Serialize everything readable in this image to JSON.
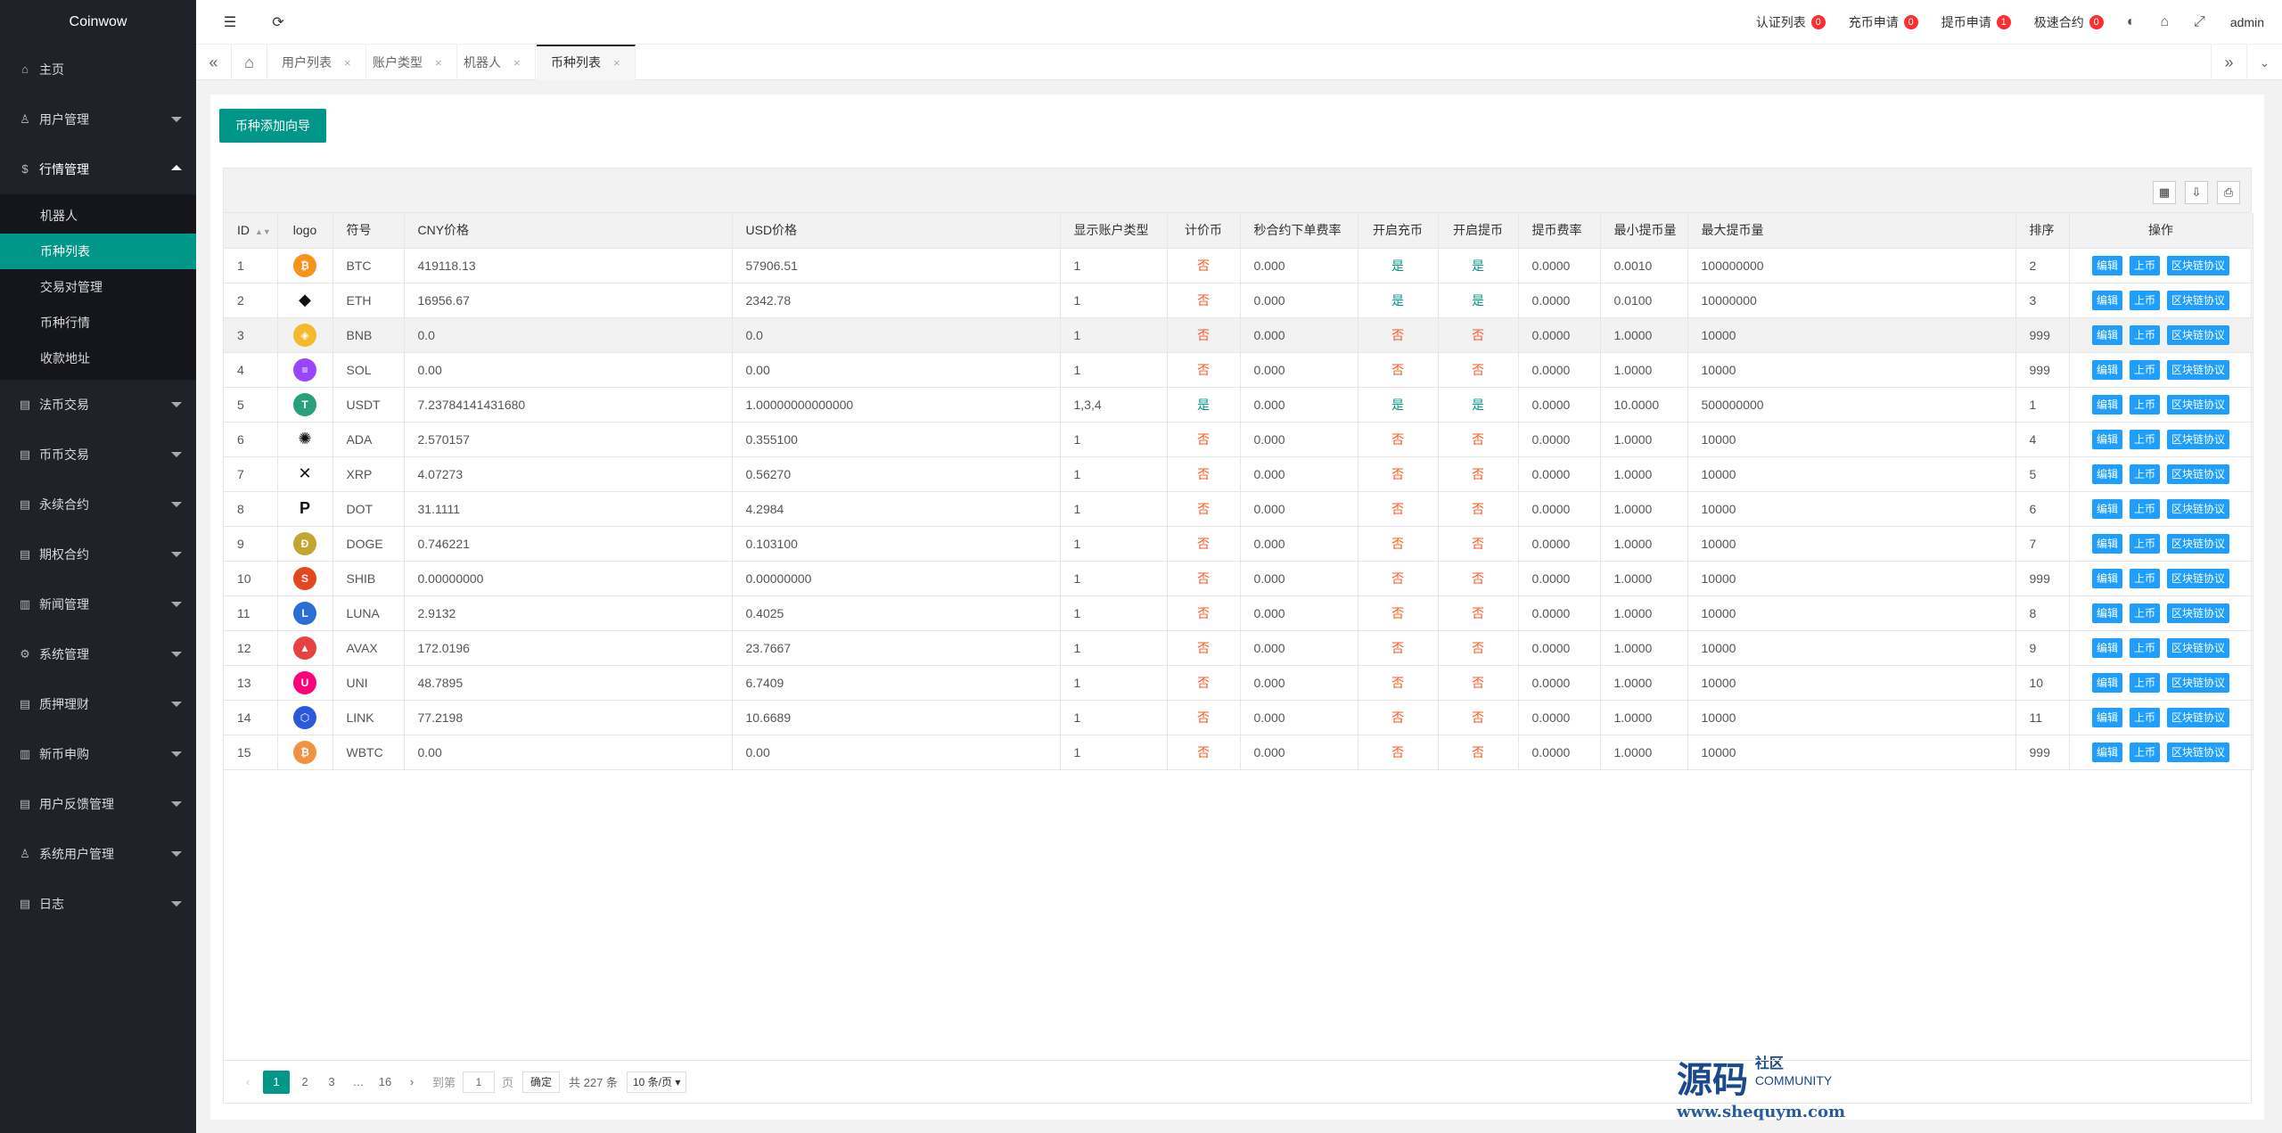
{
  "app": {
    "name": "Coinwow"
  },
  "sidebar": {
    "items": [
      {
        "label": "主页",
        "icon": "home-icon"
      },
      {
        "label": "用户管理",
        "icon": "user-icon"
      },
      {
        "label": "行情管理",
        "icon": "dollar-icon",
        "open": true,
        "children": [
          "机器人",
          "币种列表",
          "交易对管理",
          "币种行情",
          "收款地址"
        ],
        "active_child": 1
      },
      {
        "label": "法币交易",
        "icon": "doc-icon"
      },
      {
        "label": "币币交易",
        "icon": "doc-icon"
      },
      {
        "label": "永续合约",
        "icon": "doc-icon"
      },
      {
        "label": "期权合约",
        "icon": "doc-icon"
      },
      {
        "label": "新闻管理",
        "icon": "news-icon"
      },
      {
        "label": "系统管理",
        "icon": "gear-icon"
      },
      {
        "label": "质押理财",
        "icon": "doc-icon"
      },
      {
        "label": "新币申购",
        "icon": "news-icon"
      },
      {
        "label": "用户反馈管理",
        "icon": "doc-icon"
      },
      {
        "label": "系统用户管理",
        "icon": "user-icon"
      },
      {
        "label": "日志",
        "icon": "doc-icon"
      }
    ]
  },
  "header": {
    "links": [
      {
        "label": "认证列表",
        "count": "0"
      },
      {
        "label": "充币申请",
        "count": "0"
      },
      {
        "label": "提币申请",
        "count": "1"
      },
      {
        "label": "极速合约",
        "count": "0"
      }
    ],
    "user": "admin"
  },
  "tabs": [
    {
      "label": "用户列表"
    },
    {
      "label": "账户类型"
    },
    {
      "label": "机器人"
    },
    {
      "label": "币种列表",
      "active": true
    }
  ],
  "main": {
    "add_button": "币种添加向导",
    "columns": [
      "ID",
      "logo",
      "符号",
      "CNY价格",
      "USD价格",
      "显示账户类型",
      "计价币",
      "秒合约下单费率",
      "开启充币",
      "开启提币",
      "提币费率",
      "最小提币量",
      "最大提币量",
      "排序",
      "操作"
    ],
    "rows": [
      {
        "id": "1",
        "color": "#f7931a",
        "glyph": "₿",
        "symbol": "BTC",
        "cny": "419118.13",
        "usd": "57906.51",
        "acct": "1",
        "quote": "否",
        "fee": "0.000",
        "dep": "是",
        "wd": "是",
        "wdfee": "0.0000",
        "min": "0.0010",
        "max": "100000000",
        "sort": "2"
      },
      {
        "id": "2",
        "color": "#ffffff",
        "glyph": "◆",
        "symbol": "ETH",
        "cny": "16956.67",
        "usd": "2342.78",
        "acct": "1",
        "quote": "否",
        "fee": "0.000",
        "dep": "是",
        "wd": "是",
        "wdfee": "0.0000",
        "min": "0.0100",
        "max": "10000000",
        "sort": "3"
      },
      {
        "id": "3",
        "color": "#f3ba2f",
        "glyph": "◈",
        "symbol": "BNB",
        "cny": "0.0",
        "usd": "0.0",
        "acct": "1",
        "quote": "否",
        "fee": "0.000",
        "dep": "否",
        "wd": "否",
        "wdfee": "0.0000",
        "min": "1.0000",
        "max": "10000",
        "sort": "999"
      },
      {
        "id": "4",
        "color": "#9945ff",
        "glyph": "≡",
        "symbol": "SOL",
        "cny": "0.00",
        "usd": "0.00",
        "acct": "1",
        "quote": "否",
        "fee": "0.000",
        "dep": "否",
        "wd": "否",
        "wdfee": "0.0000",
        "min": "1.0000",
        "max": "10000",
        "sort": "999"
      },
      {
        "id": "5",
        "color": "#26a17b",
        "glyph": "T",
        "symbol": "USDT",
        "cny": "7.23784141431680",
        "usd": "1.00000000000000",
        "acct": "1,3,4",
        "quote": "是",
        "fee": "0.000",
        "dep": "是",
        "wd": "是",
        "wdfee": "0.0000",
        "min": "10.0000",
        "max": "500000000",
        "sort": "1"
      },
      {
        "id": "6",
        "color": "#ffffff",
        "glyph": "✺",
        "symbol": "ADA",
        "cny": "2.570157",
        "usd": "0.355100",
        "acct": "1",
        "quote": "否",
        "fee": "0.000",
        "dep": "否",
        "wd": "否",
        "wdfee": "0.0000",
        "min": "1.0000",
        "max": "10000",
        "sort": "4"
      },
      {
        "id": "7",
        "color": "#ffffff",
        "glyph": "✕",
        "symbol": "XRP",
        "cny": "4.07273",
        "usd": "0.56270",
        "acct": "1",
        "quote": "否",
        "fee": "0.000",
        "dep": "否",
        "wd": "否",
        "wdfee": "0.0000",
        "min": "1.0000",
        "max": "10000",
        "sort": "5"
      },
      {
        "id": "8",
        "color": "#ffffff",
        "glyph": "P",
        "symbol": "DOT",
        "cny": "31.1111",
        "usd": "4.2984",
        "acct": "1",
        "quote": "否",
        "fee": "0.000",
        "dep": "否",
        "wd": "否",
        "wdfee": "0.0000",
        "min": "1.0000",
        "max": "10000",
        "sort": "6"
      },
      {
        "id": "9",
        "color": "#c2a633",
        "glyph": "Ð",
        "symbol": "DOGE",
        "cny": "0.746221",
        "usd": "0.103100",
        "acct": "1",
        "quote": "否",
        "fee": "0.000",
        "dep": "否",
        "wd": "否",
        "wdfee": "0.0000",
        "min": "1.0000",
        "max": "10000",
        "sort": "7"
      },
      {
        "id": "10",
        "color": "#e5461f",
        "glyph": "S",
        "symbol": "SHIB",
        "cny": "0.00000000",
        "usd": "0.00000000",
        "acct": "1",
        "quote": "否",
        "fee": "0.000",
        "dep": "否",
        "wd": "否",
        "wdfee": "0.0000",
        "min": "1.0000",
        "max": "10000",
        "sort": "999"
      },
      {
        "id": "11",
        "color": "#2b6fd6",
        "glyph": "L",
        "symbol": "LUNA",
        "cny": "2.9132",
        "usd": "0.4025",
        "acct": "1",
        "quote": "否",
        "fee": "0.000",
        "dep": "否",
        "wd": "否",
        "wdfee": "0.0000",
        "min": "1.0000",
        "max": "10000",
        "sort": "8"
      },
      {
        "id": "12",
        "color": "#e84142",
        "glyph": "▲",
        "symbol": "AVAX",
        "cny": "172.0196",
        "usd": "23.7667",
        "acct": "1",
        "quote": "否",
        "fee": "0.000",
        "dep": "否",
        "wd": "否",
        "wdfee": "0.0000",
        "min": "1.0000",
        "max": "10000",
        "sort": "9"
      },
      {
        "id": "13",
        "color": "#ff007a",
        "glyph": "U",
        "symbol": "UNI",
        "cny": "48.7895",
        "usd": "6.7409",
        "acct": "1",
        "quote": "否",
        "fee": "0.000",
        "dep": "否",
        "wd": "否",
        "wdfee": "0.0000",
        "min": "1.0000",
        "max": "10000",
        "sort": "10"
      },
      {
        "id": "14",
        "color": "#2a5ada",
        "glyph": "⬡",
        "symbol": "LINK",
        "cny": "77.2198",
        "usd": "10.6689",
        "acct": "1",
        "quote": "否",
        "fee": "0.000",
        "dep": "否",
        "wd": "否",
        "wdfee": "0.0000",
        "min": "1.0000",
        "max": "10000",
        "sort": "11"
      },
      {
        "id": "15",
        "color": "#f09242",
        "glyph": "₿",
        "symbol": "WBTC",
        "cny": "0.00",
        "usd": "0.00",
        "acct": "1",
        "quote": "否",
        "fee": "0.000",
        "dep": "否",
        "wd": "否",
        "wdfee": "0.0000",
        "min": "1.0000",
        "max": "10000",
        "sort": "999"
      }
    ],
    "actions": [
      "编辑",
      "上币",
      "区块链协议"
    ],
    "highlighted_row": 3
  },
  "pager": {
    "pages": [
      "1",
      "2",
      "3",
      "…",
      "16"
    ],
    "current": "1",
    "goto_label": "到第",
    "goto_value": "1",
    "page_unit": "页",
    "confirm": "确定",
    "total": "共 227 条",
    "per_page": "10 条/页"
  },
  "watermark": {
    "title": "源码",
    "sub1": "社区",
    "sub2": "COMMUNITY",
    "url": "www.shequym.com"
  }
}
